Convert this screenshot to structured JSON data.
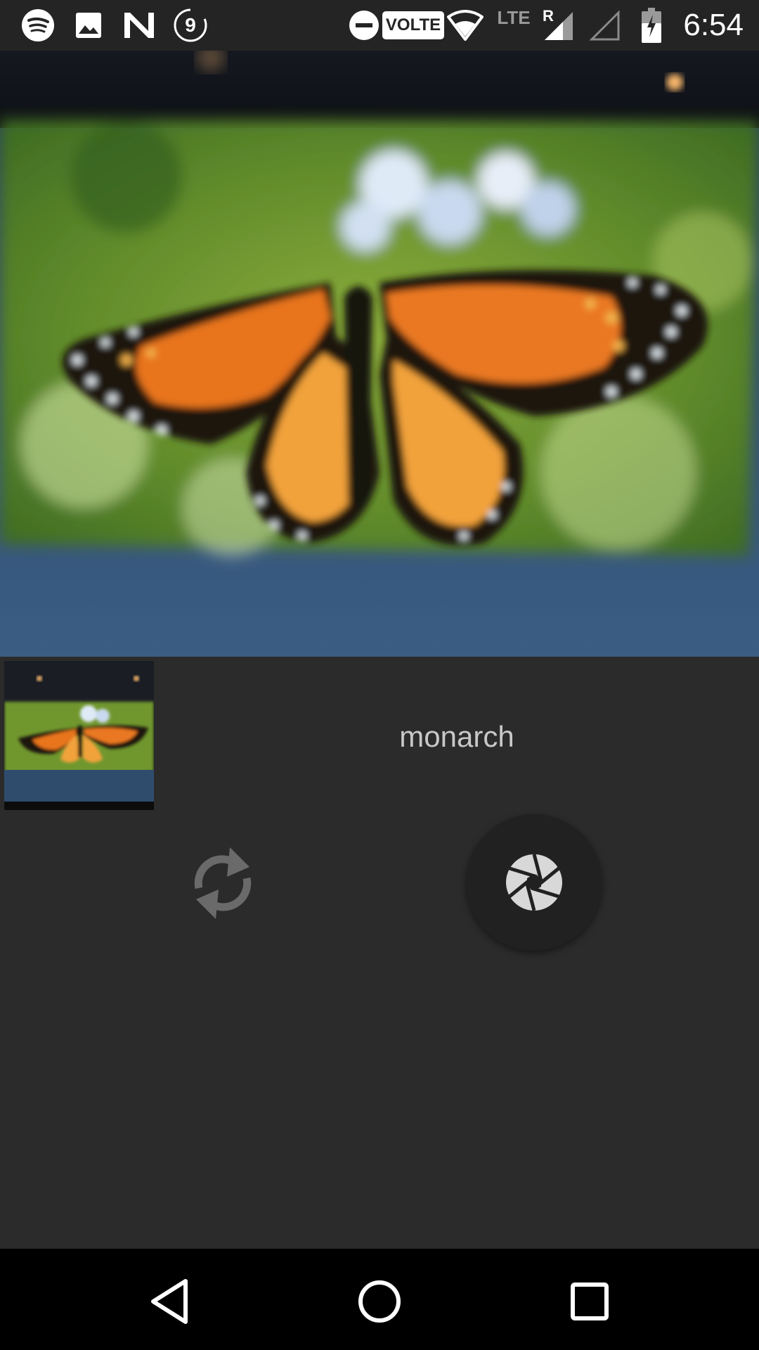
{
  "status_bar": {
    "time": "6:54",
    "notification_badge": "9",
    "volte_label": "VOLTE",
    "lte_label": "LTE",
    "roaming_label": "R",
    "icons": [
      "spotify-icon",
      "image-icon",
      "n-icon",
      "badge-9-icon",
      "dnd-icon",
      "volte-icon",
      "wifi-icon",
      "lte-icon",
      "signal-icon",
      "signal-empty-icon",
      "battery-charging-icon"
    ]
  },
  "main": {
    "result_label": "monarch"
  },
  "controls": {
    "refresh_icon": "refresh-icon",
    "shutter_icon": "camera-aperture-icon"
  },
  "nav_bar": {
    "icons": [
      "back-icon",
      "home-icon",
      "recents-icon"
    ]
  },
  "colors": {
    "background": "#2b2b2b",
    "status_bar": "#242424",
    "nav_bar": "#000000",
    "label_text": "#c8c8c8",
    "shutter_bg": "#212121"
  }
}
